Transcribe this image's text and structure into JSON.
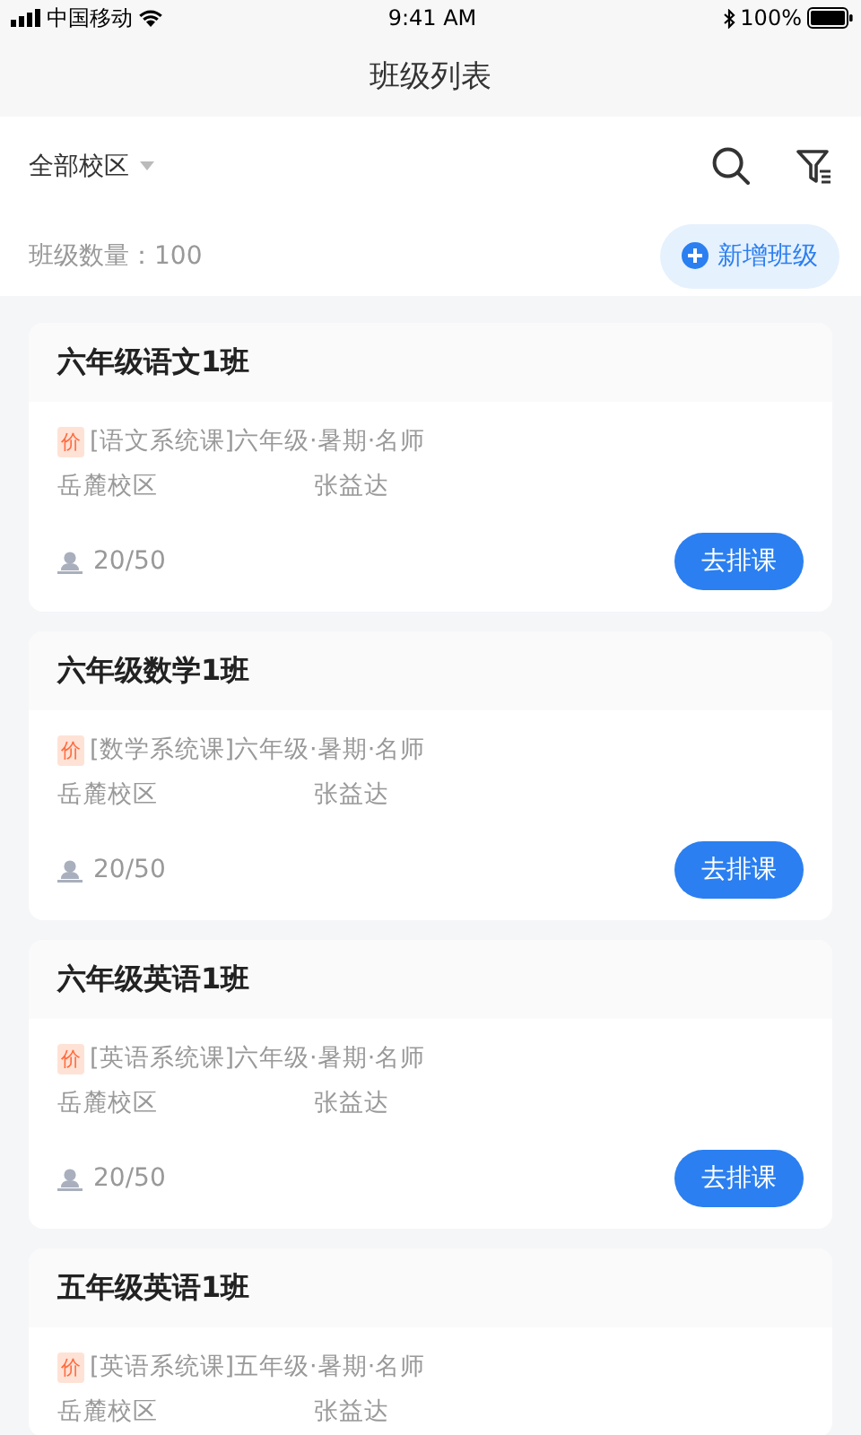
{
  "status_bar": {
    "carrier": "中国移动",
    "time": "9:41 AM",
    "battery": "100%"
  },
  "nav": {
    "title": "班级列表"
  },
  "filter": {
    "campus": "全部校区"
  },
  "summary": {
    "count": "班级数量：100",
    "add_button": "新增班级"
  },
  "classes": [
    {
      "name": "六年级语文1班",
      "tag": "价",
      "course": "[语文系统课]六年级·暑期·名师",
      "campus": "岳麓校区",
      "teacher": "张益达",
      "enrollment": "20/50",
      "action": "去排课"
    },
    {
      "name": "六年级数学1班",
      "tag": "价",
      "course": "[数学系统课]六年级·暑期·名师",
      "campus": "岳麓校区",
      "teacher": "张益达",
      "enrollment": "20/50",
      "action": "去排课"
    },
    {
      "name": "六年级英语1班",
      "tag": "价",
      "course": "[英语系统课]六年级·暑期·名师",
      "campus": "岳麓校区",
      "teacher": "张益达",
      "enrollment": "20/50",
      "action": "去排课"
    },
    {
      "name": "五年级英语1班",
      "tag": "价",
      "course": "[英语系统课]五年级·暑期·名师",
      "campus": "岳麓校区",
      "teacher": "张益达"
    }
  ]
}
